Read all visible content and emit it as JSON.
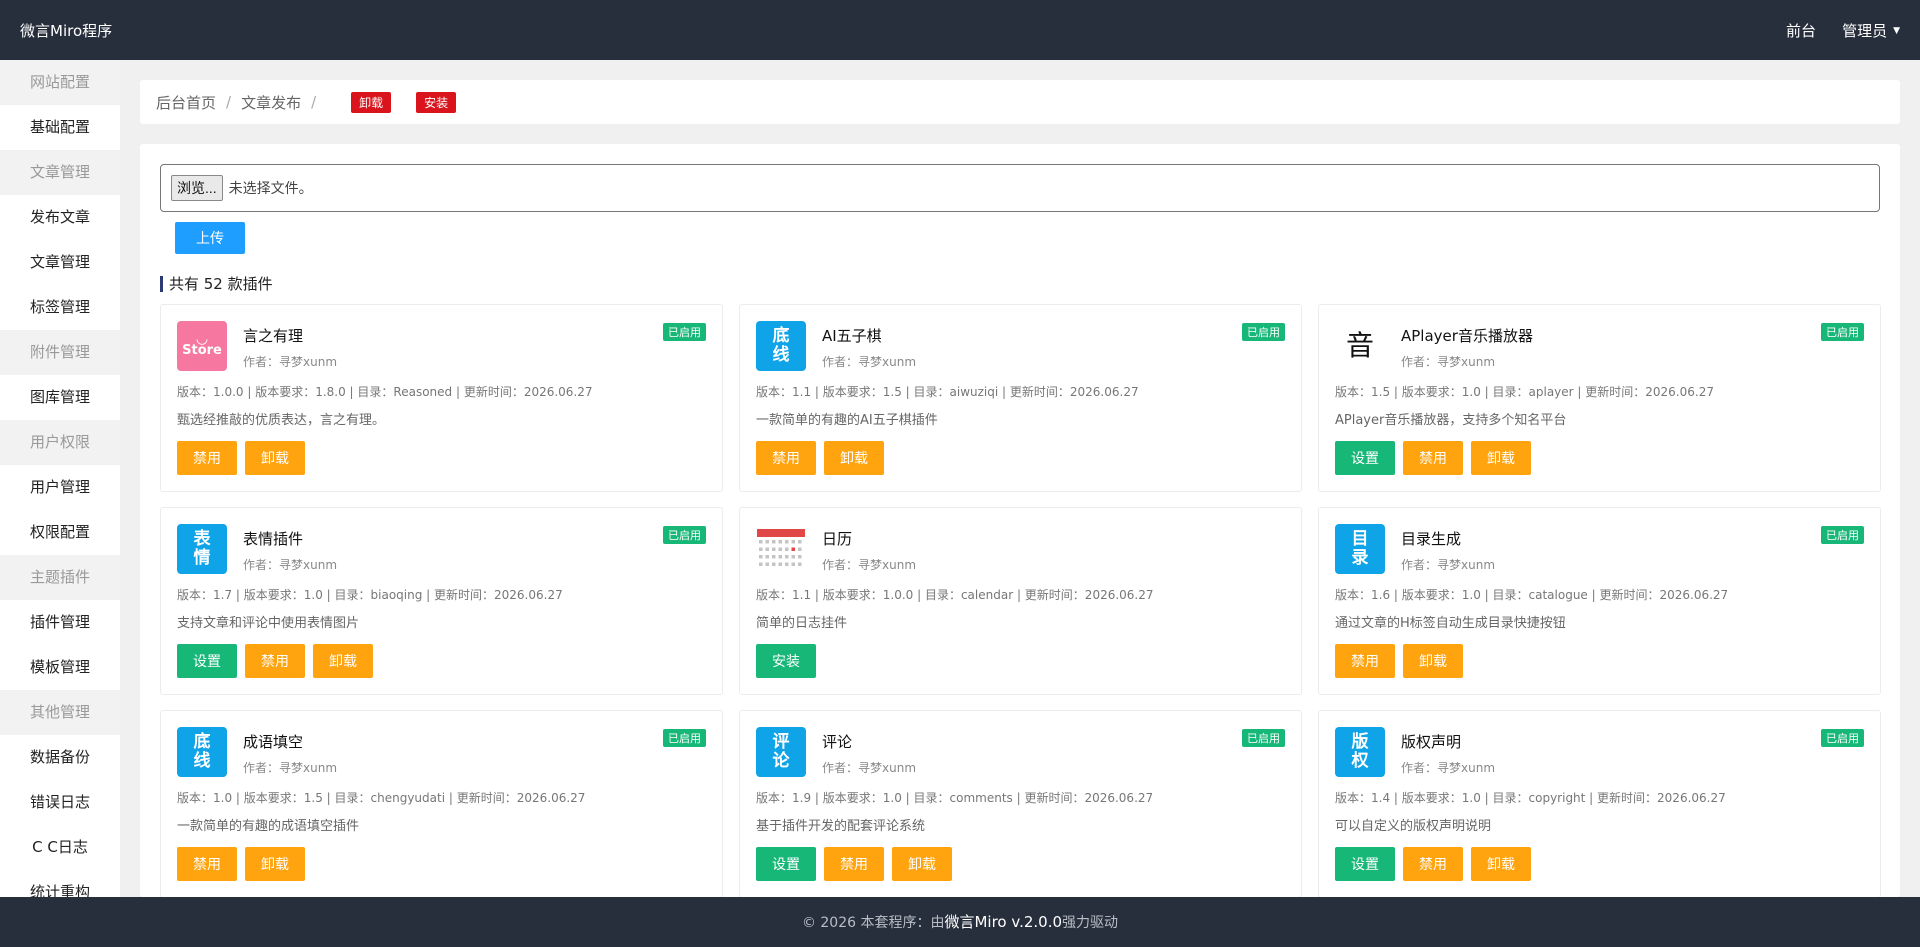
{
  "header": {
    "brand": "微言Miro程序",
    "nav": [
      "前台",
      "管理员"
    ]
  },
  "sidebar": [
    {
      "type": "group",
      "label": "网站配置"
    },
    {
      "type": "item",
      "label": "基础配置"
    },
    {
      "type": "group",
      "label": "文章管理"
    },
    {
      "type": "item",
      "label": "发布文章"
    },
    {
      "type": "item",
      "label": "文章管理"
    },
    {
      "type": "item",
      "label": "标签管理"
    },
    {
      "type": "group",
      "label": "附件管理"
    },
    {
      "type": "item",
      "label": "图库管理"
    },
    {
      "type": "group",
      "label": "用户权限"
    },
    {
      "type": "item",
      "label": "用户管理"
    },
    {
      "type": "item",
      "label": "权限配置"
    },
    {
      "type": "group",
      "label": "主题插件"
    },
    {
      "type": "item",
      "label": "插件管理"
    },
    {
      "type": "item",
      "label": "模板管理"
    },
    {
      "type": "group",
      "label": "其他管理"
    },
    {
      "type": "item",
      "label": "数据备份"
    },
    {
      "type": "item",
      "label": "错误日志"
    },
    {
      "type": "item",
      "label": "C C日志"
    },
    {
      "type": "item",
      "label": "统计重构"
    }
  ],
  "breadcrumb": {
    "home": "后台首页",
    "current": "文章发布",
    "sep": "/",
    "tags": [
      "卸载",
      "安装"
    ]
  },
  "upload": {
    "browse": "浏览...",
    "no_file": "未选择文件。",
    "button": "上传"
  },
  "count_title": "共有 52 款插件",
  "plugins": [
    {
      "name": "言之有理",
      "author": "作者：寻梦xunm",
      "badge": "已启用",
      "meta": "版本：1.0.0 | 版本要求：1.8.0 | 目录：Reasoned | 更新时间：2026.06.27",
      "desc": "甄选经推敲的优质表达，言之有理。",
      "icon": {
        "style": "store-icon",
        "text": "Store"
      },
      "buttons": [
        {
          "label": "禁用",
          "color": "orange"
        },
        {
          "label": "卸载",
          "color": "orange"
        }
      ]
    },
    {
      "name": "AI五子棋",
      "author": "作者：寻梦xunm",
      "badge": "已启用",
      "meta": "版本：1.1 | 版本要求：1.5 | 目录：aiwuziqi | 更新时间：2026.06.27",
      "desc": "一款简单的有趣的AI五子棋插件",
      "icon": {
        "style": "text-icon",
        "text": "底 线"
      },
      "buttons": [
        {
          "label": "禁用",
          "color": "orange"
        },
        {
          "label": "卸载",
          "color": "orange"
        }
      ]
    },
    {
      "name": "APlayer音乐播放器",
      "author": "作者：寻梦xunm",
      "badge": "已启用",
      "meta": "版本：1.5 | 版本要求：1.0 | 目录：aplayer | 更新时间：2026.06.27",
      "desc": "APlayer音乐播放器，支持多个知名平台",
      "icon": {
        "style": "plain-icon",
        "text": "音"
      },
      "buttons": [
        {
          "label": "设置",
          "color": "green"
        },
        {
          "label": "禁用",
          "color": "orange"
        },
        {
          "label": "卸载",
          "color": "orange"
        }
      ]
    },
    {
      "name": "表情插件",
      "author": "作者：寻梦xunm",
      "badge": "已启用",
      "meta": "版本：1.7 | 版本要求：1.0 | 目录：biaoqing | 更新时间：2026.06.27",
      "desc": "支持文章和评论中使用表情图片",
      "icon": {
        "style": "text-icon",
        "text": "表 情"
      },
      "buttons": [
        {
          "label": "设置",
          "color": "green"
        },
        {
          "label": "禁用",
          "color": "orange"
        },
        {
          "label": "卸载",
          "color": "orange"
        }
      ]
    },
    {
      "name": "日历",
      "author": "作者：寻梦xunm",
      "badge": "",
      "meta": "版本：1.1 | 版本要求：1.0.0 | 目录：calendar | 更新时间：2026.06.27",
      "desc": "简单的日志挂件",
      "icon": {
        "style": "calendar-icon",
        "text": ""
      },
      "buttons": [
        {
          "label": "安装",
          "color": "green"
        }
      ]
    },
    {
      "name": "目录生成",
      "author": "作者：寻梦xunm",
      "badge": "已启用",
      "meta": "版本：1.6 | 版本要求：1.0 | 目录：catalogue | 更新时间：2026.06.27",
      "desc": "通过文章的H标签自动生成目录快捷按钮",
      "icon": {
        "style": "text-icon",
        "text": "目 录"
      },
      "buttons": [
        {
          "label": "禁用",
          "color": "orange"
        },
        {
          "label": "卸载",
          "color": "orange"
        }
      ]
    },
    {
      "name": "成语填空",
      "author": "作者：寻梦xunm",
      "badge": "已启用",
      "meta": "版本：1.0 | 版本要求：1.5 | 目录：chengyudati | 更新时间：2026.06.27",
      "desc": "一款简单的有趣的成语填空插件",
      "icon": {
        "style": "text-icon",
        "text": "底 线"
      },
      "buttons": [
        {
          "label": "禁用",
          "color": "orange"
        },
        {
          "label": "卸载",
          "color": "orange"
        }
      ]
    },
    {
      "name": "评论",
      "author": "作者：寻梦xunm",
      "badge": "已启用",
      "meta": "版本：1.9 | 版本要求：1.0 | 目录：comments | 更新时间：2026.06.27",
      "desc": "基于插件开发的配套评论系统",
      "icon": {
        "style": "text-icon",
        "text": "评 论"
      },
      "buttons": [
        {
          "label": "设置",
          "color": "green"
        },
        {
          "label": "禁用",
          "color": "orange"
        },
        {
          "label": "卸载",
          "color": "orange"
        }
      ]
    },
    {
      "name": "版权声明",
      "author": "作者：寻梦xunm",
      "badge": "已启用",
      "meta": "版本：1.4 | 版本要求：1.0 | 目录：copyright | 更新时间：2026.06.27",
      "desc": "可以自定义的版权声明说明",
      "icon": {
        "style": "text-icon",
        "text": "版 权"
      },
      "buttons": [
        {
          "label": "设置",
          "color": "green"
        },
        {
          "label": "禁用",
          "color": "orange"
        },
        {
          "label": "卸载",
          "color": "orange"
        }
      ]
    }
  ],
  "footer": {
    "prefix": "© 2026 本套程序：由",
    "version": "微言Miro v.2.0.0",
    "suffix": "强力驱动"
  }
}
